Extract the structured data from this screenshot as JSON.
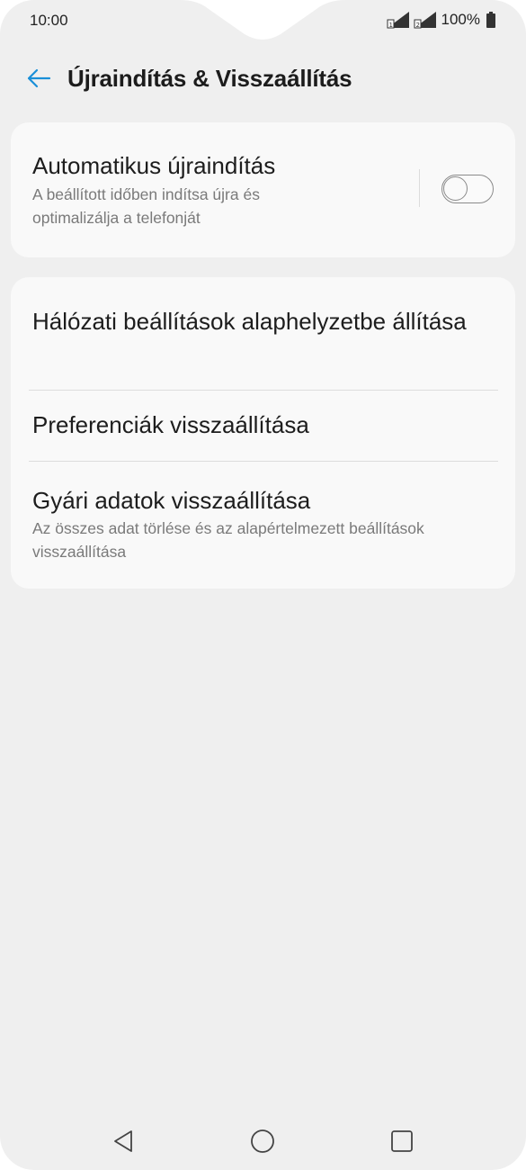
{
  "status_bar": {
    "time": "10:00",
    "battery": "100%",
    "icons": [
      "signal-sim1-icon",
      "signal-sim2-icon",
      "battery-full-icon"
    ]
  },
  "header": {
    "back_icon": "arrow-left-icon",
    "title": "Újraindítás & Visszaállítás",
    "accent_color": "#1a8fd8"
  },
  "auto_restart": {
    "title": "Automatikus újraindítás",
    "subtitle": "A beállított időben indítsa újra és optimalizálja a telefonját",
    "toggle_on": false
  },
  "reset_items": [
    {
      "title": "Hálózati beállítások alaphelyzetbe állítása",
      "subtitle": ""
    },
    {
      "title": "Preferenciák visszaállítása",
      "subtitle": ""
    },
    {
      "title": "Gyári adatok visszaállítása",
      "subtitle": "Az összes adat törlése és az alapértelmezett beállítások visszaállítása"
    }
  ],
  "nav_bar": {
    "icons": [
      "triangle-back-icon",
      "circle-home-icon",
      "square-recents-icon"
    ]
  }
}
